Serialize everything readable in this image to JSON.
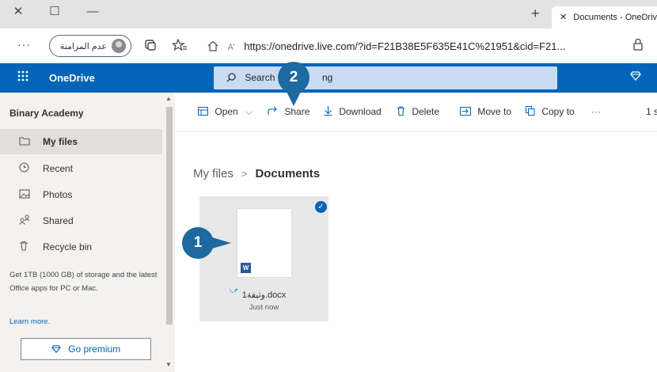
{
  "browser": {
    "window_controls": {
      "close": "✕",
      "maximize": "☐",
      "minimize": "—"
    },
    "new_tab": "+",
    "tab": {
      "close": "✕",
      "title": "Documents - OneDriv"
    },
    "more": "···",
    "inprivate_label": "عدم المزامنة",
    "url": "https://onedrive.live.com/?id=F21B38E5F635E41C%21951&cid=F21...",
    "read_aloud": "A’",
    "icons": [
      "tab-actions-icon",
      "favorites-icon",
      "home-icon",
      "lock-icon"
    ]
  },
  "onedrive": {
    "brand": "OneDrive",
    "search_prefix": "Search",
    "search_suffix": "ng",
    "premium_icon": "diamond-icon"
  },
  "sidebar": {
    "account": "Binary Academy",
    "items": [
      {
        "label": "My files",
        "icon": "folder-icon",
        "active": true
      },
      {
        "label": "Recent",
        "icon": "clock-icon",
        "active": false
      },
      {
        "label": "Photos",
        "icon": "image-icon",
        "active": false
      },
      {
        "label": "Shared",
        "icon": "people-icon",
        "active": false
      },
      {
        "label": "Recycle bin",
        "icon": "trash-icon",
        "active": false
      }
    ],
    "promo": "Get 1TB (1000 GB) of storage and the latest Office apps for PC or Mac.",
    "learn_more": "Learn more.",
    "go_premium": "Go premium"
  },
  "commands": {
    "open": "Open",
    "share": "Share",
    "download": "Download",
    "delete": "Delete",
    "move_to": "Move to",
    "copy_to": "Copy to",
    "more": "···",
    "selected": "1 s"
  },
  "breadcrumb": {
    "root": "My files",
    "separator": ">",
    "current": "Documents"
  },
  "file": {
    "name": "وثيقة1.docx",
    "time": "Just now",
    "type_badge": "W"
  },
  "callouts": [
    "1",
    "2"
  ],
  "colors": {
    "accent": "#0364b8",
    "callout": "#1c6a9f",
    "word": "#2b579a"
  }
}
